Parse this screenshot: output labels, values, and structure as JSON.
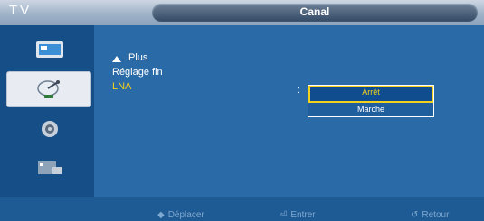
{
  "header": {
    "app_label": "TV",
    "title": "Canal"
  },
  "sidebar": {
    "items": [
      {
        "name": "picture",
        "icon": "picture-icon",
        "active": false
      },
      {
        "name": "channel",
        "icon": "satellite-dish-icon",
        "active": true
      },
      {
        "name": "setup",
        "icon": "gear-icon",
        "active": false
      },
      {
        "name": "input",
        "icon": "input-icon",
        "active": false
      }
    ]
  },
  "menu": {
    "more_label": "Plus",
    "items": [
      {
        "label": "Réglage fin",
        "selected": false
      },
      {
        "label": "LNA",
        "selected": true
      }
    ],
    "colon": ":"
  },
  "dropdown": {
    "options": [
      {
        "label": "Arrêt",
        "selected": true
      },
      {
        "label": "Marche",
        "selected": false
      }
    ]
  },
  "footer": {
    "move": {
      "icon": "move-icon",
      "label": "Déplacer"
    },
    "enter": {
      "icon": "enter-icon",
      "label": "Entrer"
    },
    "return": {
      "icon": "return-icon",
      "label": "Retour"
    }
  },
  "colors": {
    "background": "#1e5a93",
    "panel": "#2a6aa6",
    "highlight_text": "#f3d11c",
    "hint_text": "#7fa8d0"
  }
}
